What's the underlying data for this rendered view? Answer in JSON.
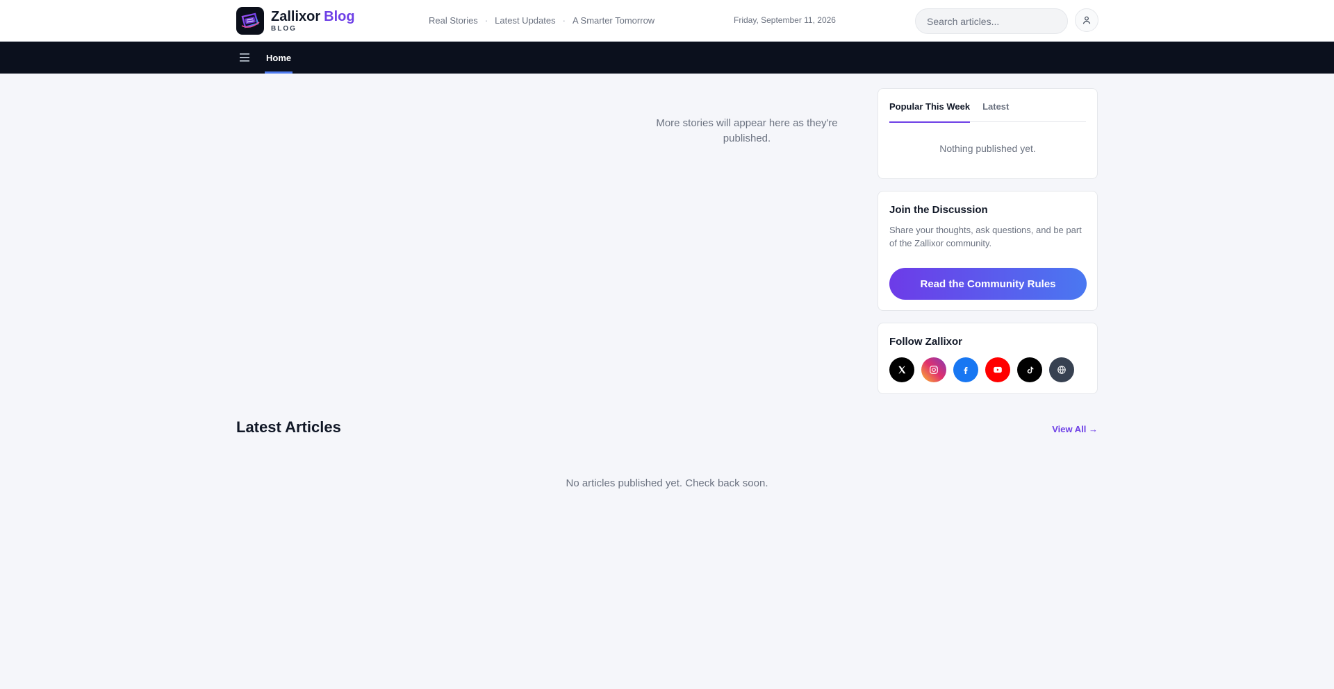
{
  "header": {
    "brand_name": "Zallixor",
    "brand_accent": "Blog",
    "brand_sub": "BLOG",
    "tagline": [
      "Real Stories",
      "Latest Updates",
      "A Smarter Tomorrow"
    ],
    "tagline_separator": "·",
    "date": "Friday, September 11, 2026",
    "search_placeholder": "Search articles...",
    "user_icon": "user-icon"
  },
  "nav": {
    "menu_icon": "hamburger-icon",
    "items": [
      {
        "label": "Home",
        "active": true
      }
    ]
  },
  "main": {
    "feature_empty": "More stories will appear here as they're published.",
    "latest_title": "Latest Articles",
    "view_all": "View All →",
    "latest_empty": "No articles published yet. Check back soon."
  },
  "sidebar": {
    "popular": {
      "tabs": [
        {
          "label": "Popular This Week",
          "active": true
        },
        {
          "label": "Latest",
          "active": false
        }
      ],
      "empty": "Nothing published yet."
    },
    "discussion": {
      "title": "Join the Discussion",
      "description": "Share your thoughts, ask questions, and be part of the Zallixor community.",
      "button": "Read the Community Rules"
    },
    "follow": {
      "title": "Follow Zallixor",
      "socials": [
        {
          "icon": "x-icon",
          "color": "#000000"
        },
        {
          "icon": "instagram-icon",
          "color": "#d6249f"
        },
        {
          "icon": "facebook-icon",
          "color": "#1877f2"
        },
        {
          "icon": "youtube-icon",
          "color": "#ff0000"
        },
        {
          "icon": "tiktok-icon",
          "color": "#000000"
        },
        {
          "icon": "globe-icon",
          "color": "#374151"
        }
      ]
    }
  },
  "colors": {
    "accent": "#6d3fe6",
    "navbar": "#0b101d",
    "background": "#f5f6fa"
  }
}
